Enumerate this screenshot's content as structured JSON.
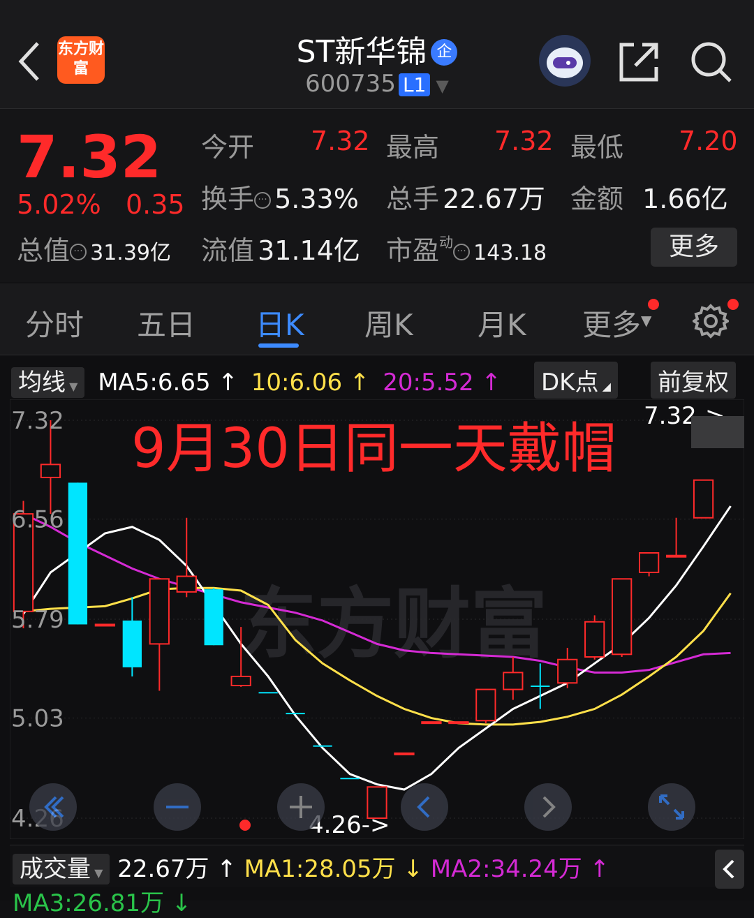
{
  "header": {
    "logo_text": "东方财富",
    "stock_name": "ST新华锦",
    "name_badge": "企",
    "code": "600735",
    "level_badge": "L1"
  },
  "quote": {
    "price": "7.32",
    "change_pct": "5.02%",
    "change_amt": "0.35",
    "open_label": "今开",
    "open_value": "7.32",
    "high_label": "最高",
    "high_value": "7.32",
    "low_label": "最低",
    "low_value": "7.20",
    "turnover_label": "换手",
    "turnover_value": "5.33%",
    "volume_label": "总手",
    "volume_value": "22.67万",
    "amount_label": "金额",
    "amount_value": "1.66亿",
    "mktcap_label": "总值",
    "mktcap_value": "31.39亿",
    "float_label": "流值",
    "float_value": "31.14亿",
    "pe_label": "市盈",
    "pe_sup": "动",
    "pe_value": "143.18",
    "more_button": "更多"
  },
  "tabs": [
    "分时",
    "五日",
    "日K",
    "周K",
    "月K",
    "更多"
  ],
  "active_tab": "日K",
  "chart_toolbar": {
    "indicator_select": "均线",
    "ma5": "MA5:6.65",
    "ma10": "10:6.06",
    "ma20": "20:5.52",
    "dk_button": "DK点",
    "adjust_button": "前复权"
  },
  "annotation": "9月30日同一天戴帽",
  "watermark": "东方财富",
  "colors": {
    "up": "#ff2a2a",
    "down": "#00e5ff",
    "ma5": "#ffffff",
    "ma10": "#ffe04a",
    "ma20": "#d42ad4",
    "accent": "#3d8bff"
  },
  "chart_data": {
    "type": "candlestick",
    "y_ticks": [
      "7.32",
      "6.56",
      "5.79",
      "5.03",
      "4.26"
    ],
    "ylim": [
      4.26,
      7.32
    ],
    "high_marker": "7.32->",
    "low_marker": "4.26->",
    "candles": [
      {
        "o": 5.85,
        "c": 6.6,
        "h": 6.7,
        "l": 5.72,
        "dir": "up"
      },
      {
        "o": 6.88,
        "c": 6.98,
        "h": 7.32,
        "l": 6.6,
        "dir": "up"
      },
      {
        "o": 6.84,
        "c": 5.75,
        "h": 6.84,
        "l": 5.75,
        "dir": "down"
      },
      {
        "o": 5.75,
        "c": 5.75,
        "h": 5.75,
        "l": 5.75,
        "dir": "up"
      },
      {
        "o": 5.78,
        "c": 5.42,
        "h": 5.96,
        "l": 5.35,
        "dir": "down"
      },
      {
        "o": 5.6,
        "c": 6.1,
        "h": 6.1,
        "l": 5.24,
        "dir": "up"
      },
      {
        "o": 6.0,
        "c": 6.12,
        "h": 6.57,
        "l": 5.96,
        "dir": "up"
      },
      {
        "o": 6.02,
        "c": 5.59,
        "h": 6.03,
        "l": 5.59,
        "dir": "down"
      },
      {
        "o": 5.28,
        "c": 5.35,
        "h": 5.73,
        "l": 5.27,
        "dir": "up"
      },
      {
        "o": 5.23,
        "c": 5.23,
        "h": 5.23,
        "l": 5.23,
        "dir": "down"
      },
      {
        "o": 5.07,
        "c": 5.07,
        "h": 5.07,
        "l": 5.07,
        "dir": "down"
      },
      {
        "o": 4.82,
        "c": 4.82,
        "h": 4.82,
        "l": 4.82,
        "dir": "down"
      },
      {
        "o": 4.57,
        "c": 4.57,
        "h": 4.57,
        "l": 4.57,
        "dir": "down"
      },
      {
        "o": 4.26,
        "c": 4.5,
        "h": 4.5,
        "l": 4.26,
        "dir": "up"
      },
      {
        "o": 4.76,
        "c": 4.76,
        "h": 4.76,
        "l": 4.76,
        "dir": "up"
      },
      {
        "o": 5.0,
        "c": 5.0,
        "h": 5.0,
        "l": 5.0,
        "dir": "up"
      },
      {
        "o": 5.0,
        "c": 5.0,
        "h": 5.0,
        "l": 5.0,
        "dir": "up"
      },
      {
        "o": 5.01,
        "c": 5.25,
        "h": 5.25,
        "l": 4.99,
        "dir": "up"
      },
      {
        "o": 5.25,
        "c": 5.38,
        "h": 5.5,
        "l": 5.17,
        "dir": "up"
      },
      {
        "o": 5.28,
        "c": 5.28,
        "h": 5.45,
        "l": 5.1,
        "dir": "down"
      },
      {
        "o": 5.3,
        "c": 5.48,
        "h": 5.57,
        "l": 5.26,
        "dir": "up"
      },
      {
        "o": 5.5,
        "c": 5.77,
        "h": 5.82,
        "l": 5.48,
        "dir": "up"
      },
      {
        "o": 5.52,
        "c": 6.1,
        "h": 6.1,
        "l": 5.5,
        "dir": "up"
      },
      {
        "o": 6.15,
        "c": 6.3,
        "h": 6.3,
        "l": 6.12,
        "dir": "up"
      },
      {
        "o": 6.28,
        "c": 6.28,
        "h": 6.57,
        "l": 6.28,
        "dir": "up"
      },
      {
        "o": 6.57,
        "c": 6.86,
        "h": 6.86,
        "l": 6.57,
        "dir": "up"
      },
      {
        "o": 7.2,
        "c": 7.32,
        "h": 7.32,
        "l": 7.2,
        "dir": "up"
      }
    ],
    "ma5": [
      5.83,
      6.15,
      6.3,
      6.45,
      6.5,
      6.4,
      6.2,
      5.9,
      5.6,
      5.35,
      5.05,
      4.8,
      4.6,
      4.52,
      4.48,
      4.6,
      4.8,
      4.95,
      5.1,
      5.2,
      5.3,
      5.45,
      5.6,
      5.8,
      6.05,
      6.35,
      6.66
    ],
    "ma10": [
      5.85,
      5.87,
      5.88,
      5.89,
      5.95,
      6.02,
      6.03,
      6.03,
      6.01,
      5.9,
      5.63,
      5.45,
      5.32,
      5.2,
      5.1,
      5.03,
      4.99,
      4.98,
      4.98,
      5.0,
      5.04,
      5.1,
      5.21,
      5.35,
      5.5,
      5.7,
      5.99
    ],
    "ma20": [
      6.6,
      6.5,
      6.38,
      6.28,
      6.18,
      6.1,
      6.04,
      5.98,
      5.92,
      5.88,
      5.84,
      5.78,
      5.69,
      5.6,
      5.55,
      5.53,
      5.52,
      5.51,
      5.5,
      5.47,
      5.42,
      5.38,
      5.38,
      5.4,
      5.46,
      5.52,
      5.53
    ]
  },
  "volume_toolbar": {
    "select": "成交量",
    "vol": "22.67万",
    "ma1": "MA1:28.05万",
    "ma2": "MA2:34.24万",
    "ma3": "MA3:26.81万"
  }
}
